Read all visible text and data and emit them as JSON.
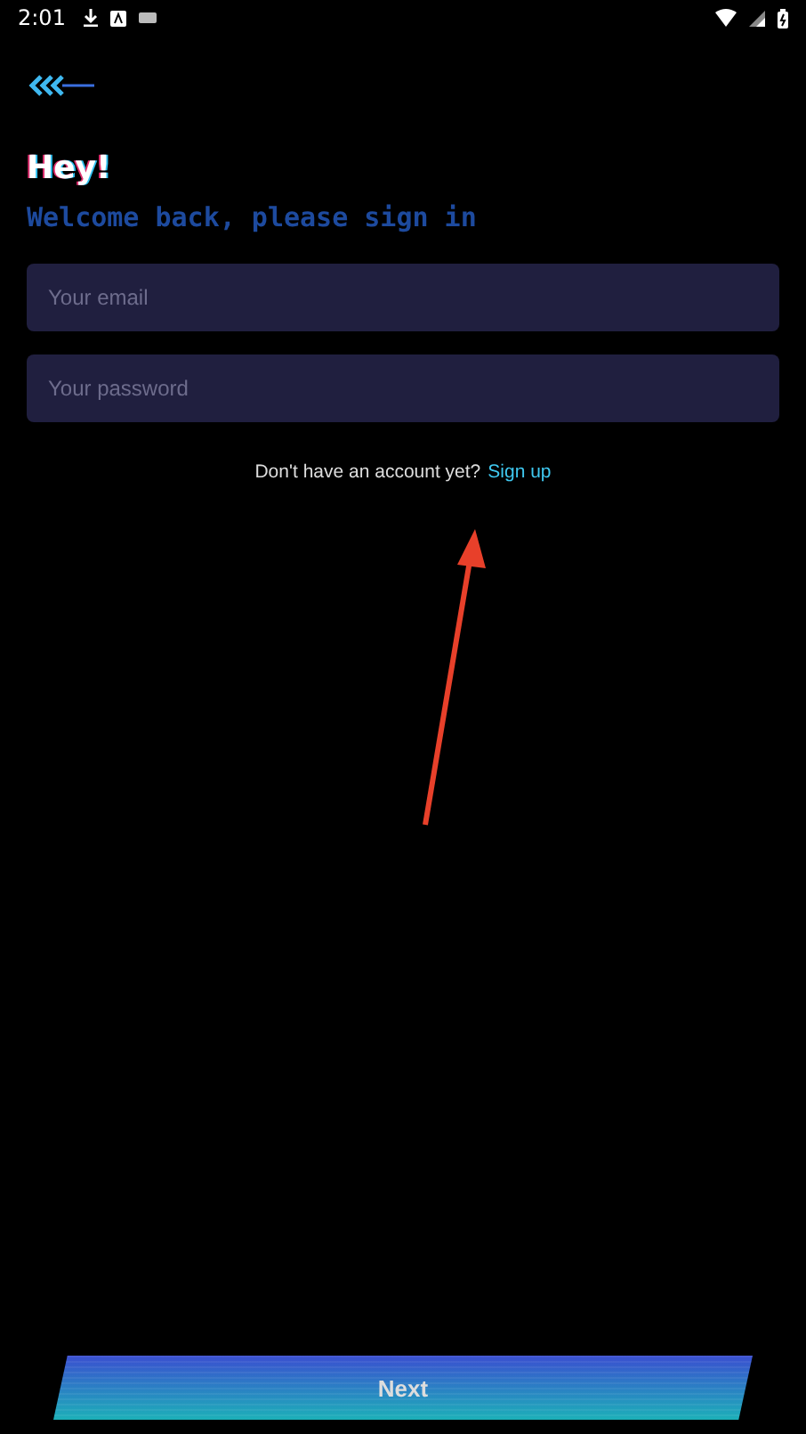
{
  "status_bar": {
    "time": "2:01"
  },
  "greeting": "Hey!",
  "subtitle": "Welcome back, please sign in",
  "fields": [
    {
      "placeholder": "Your email"
    },
    {
      "placeholder": "Your password"
    }
  ],
  "signup_prompt": {
    "text": "Don't have an account yet?",
    "link": "Sign up"
  },
  "next_button": {
    "label": "Next"
  }
}
